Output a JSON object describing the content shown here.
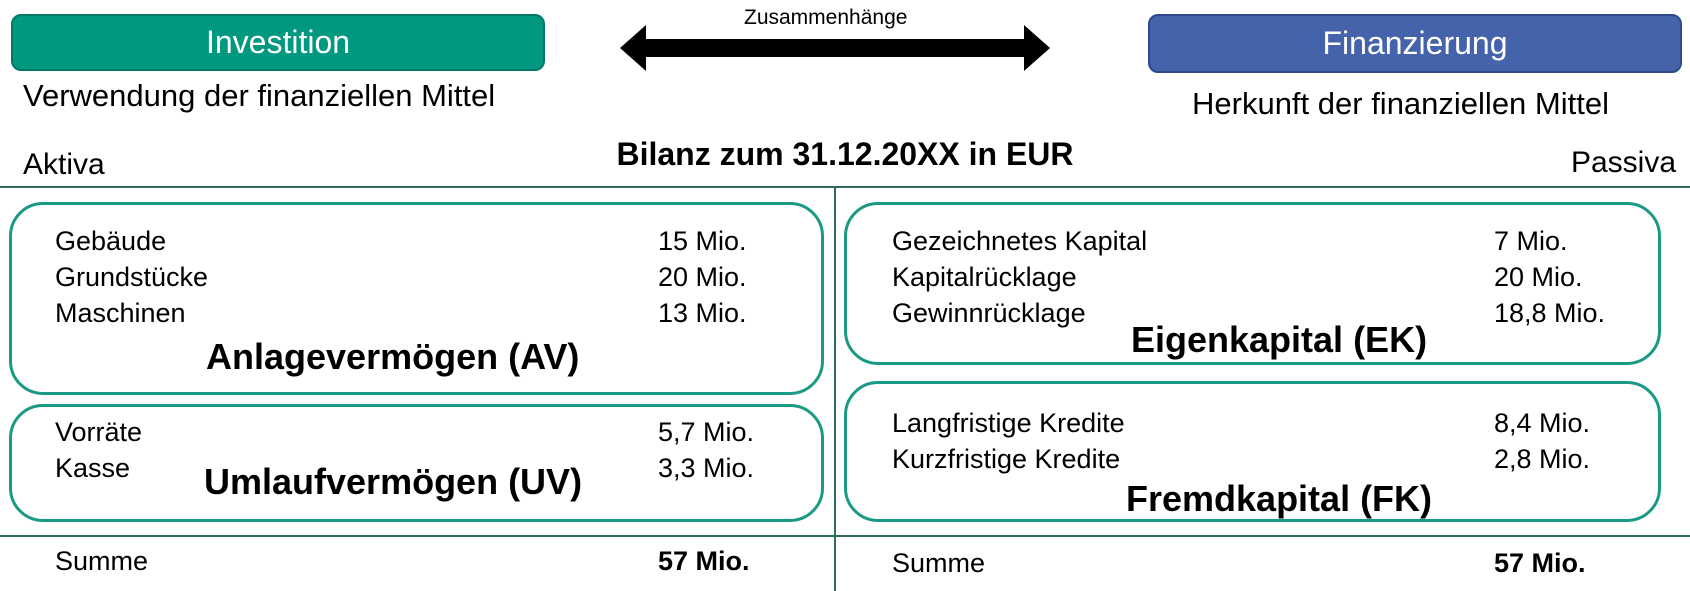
{
  "header": {
    "left_button": "Investition",
    "left_caption": "Verwendung der finanziellen Mittel",
    "arrow_label": "Zusammenhänge",
    "right_button": "Finanzierung",
    "right_caption": "Herkunft der finanziellen Mittel"
  },
  "balance": {
    "title": "Bilanz zum 31.12.20XX in EUR",
    "left_side": "Aktiva",
    "right_side": "Passiva"
  },
  "anlagevermoegen": {
    "title": "Anlagevermögen (AV)",
    "items": [
      {
        "label": "Gebäude",
        "value": "15 Mio."
      },
      {
        "label": "Grundstücke",
        "value": "20 Mio."
      },
      {
        "label": "Maschinen",
        "value": "13 Mio."
      }
    ]
  },
  "umlaufvermoegen": {
    "title": "Umlaufvermögen (UV)",
    "items": [
      {
        "label": "Vorräte",
        "value": "5,7 Mio."
      },
      {
        "label": "Kasse",
        "value": "3,3 Mio."
      }
    ]
  },
  "eigenkapital": {
    "title": "Eigenkapital (EK)",
    "items": [
      {
        "label": "Gezeichnetes Kapital",
        "value": "7 Mio."
      },
      {
        "label": "Kapitalrücklage",
        "value": "20 Mio."
      },
      {
        "label": "Gewinnrücklage",
        "value": "18,8 Mio."
      }
    ]
  },
  "fremdkapital": {
    "title": "Fremdkapital (FK)",
    "items": [
      {
        "label": "Langfristige Kredite",
        "value": "8,4 Mio."
      },
      {
        "label": "Kurzfristige Kredite",
        "value": "2,8 Mio."
      }
    ]
  },
  "totals": {
    "left_label": "Summe",
    "left_value": "57 Mio.",
    "right_label": "Summe",
    "right_value": "57 Mio."
  },
  "colors": {
    "investition": "#009980",
    "finanzierung": "#4563aa",
    "box_border": "#1a9a84"
  }
}
